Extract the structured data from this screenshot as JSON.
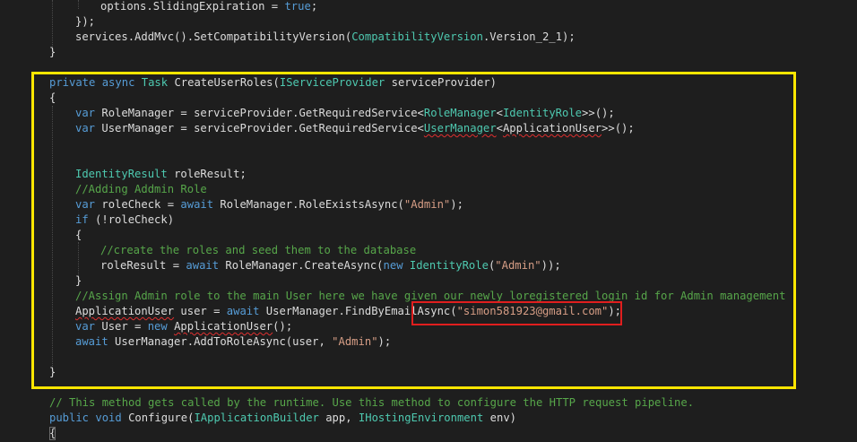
{
  "code": {
    "l1": {
      "ident": "options.SlidingExpiration = ",
      "kw": "true",
      "end": ";"
    },
    "l2": "});",
    "l3": {
      "pre": "services.AddMvc().SetCompatibilityVersion(",
      "type": "CompatibilityVersion",
      "post": ".Version_2_1);"
    },
    "l4": "}",
    "l5": {
      "kw1": "private",
      "kw2": "async",
      "type1": "Task",
      "name": " CreateUserRoles(",
      "type2": "IServiceProvider",
      "post": " serviceProvider)"
    },
    "l6": "{",
    "l7": {
      "kw": "var",
      "mid": " RoleManager = serviceProvider.GetRequiredService<",
      "type1": "RoleManager",
      "lt": "<",
      "type2": "IdentityRole",
      "end": ">>();"
    },
    "l8": {
      "kw": "var",
      "mid": " UserManager = serviceProvider.GetRequiredService<",
      "type1": "UserManager",
      "lt": "<",
      "type2": "ApplicationUser",
      "end": ">>();"
    },
    "l9": {
      "type": "IdentityResult",
      "rest": " roleResult;"
    },
    "l10": "//Adding Addmin Role",
    "l11": {
      "kw1": "var",
      "mid": " roleCheck = ",
      "kw2": "await",
      "rest": " RoleManager.RoleExistsAsync(",
      "str": "\"Admin\"",
      "end": ");"
    },
    "l12": {
      "kw": "if",
      "rest": " (!roleCheck)"
    },
    "l13": "{",
    "l14": "//create the roles and seed them to the database",
    "l15": {
      "pre": "roleResult = ",
      "kw1": "await",
      "mid": " RoleManager.CreateAsync(",
      "kw2": "new",
      "sp": " ",
      "type": "IdentityRole",
      "paren": "(",
      "str": "\"Admin\"",
      "end": "));"
    },
    "l16": "}",
    "l17": "//Assign Admin role to the main User here we have given our newly loregistered login id for Admin management",
    "l18": {
      "type": "ApplicationUser",
      "mid": " user = ",
      "kw": "await",
      "rest": " UserManager.FindByEmailAsync(",
      "str": "\"simon581923@gmail.com\"",
      "end": ");"
    },
    "l19": {
      "kw1": "var",
      "mid": " User = ",
      "kw2": "new",
      "sp": " ",
      "type": "ApplicationUser",
      "end": "();"
    },
    "l20": {
      "kw": "await",
      "rest": " UserManager.AddToRoleAsync(user, ",
      "str": "\"Admin\"",
      "end": ");"
    },
    "l21": "}",
    "l22": "// This method gets called by the runtime. Use this method to configure the HTTP request pipeline.",
    "l23": {
      "kw1": "public",
      "kw2": "void",
      "mid": " Configure(",
      "type1": "IApplicationBuilder",
      "mid2": " app, ",
      "type2": "IHostingEnvironment",
      "end": " env)"
    },
    "l24": "{"
  },
  "colors": {
    "background": "#1e1e1e",
    "keyword": "#569cd6",
    "type": "#4ec9b0",
    "string": "#d69d85",
    "comment": "#57a64a",
    "highlight_box": "#ffe600",
    "email_box": "#e01e1e"
  }
}
